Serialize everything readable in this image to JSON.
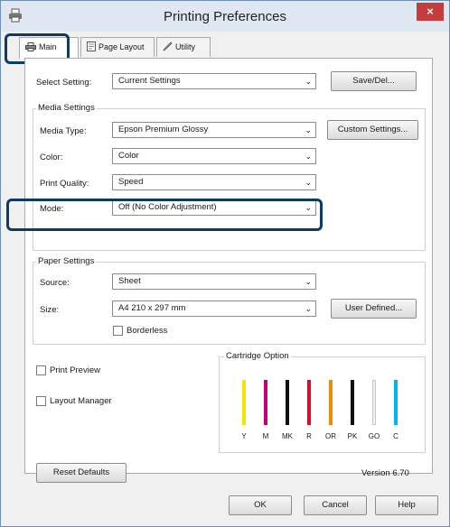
{
  "window": {
    "title": "Printing Preferences",
    "close_label": "×"
  },
  "tabs": [
    {
      "label": "Main",
      "active": true
    },
    {
      "label": "Page Layout",
      "active": false
    },
    {
      "label": "Utility",
      "active": false
    }
  ],
  "select_setting": {
    "label": "Select Setting:",
    "value": "Current Settings",
    "button": "Save/Del..."
  },
  "media_settings": {
    "title": "Media Settings",
    "media_type": {
      "label": "Media Type:",
      "value": "Epson Premium Glossy"
    },
    "custom_button": "Custom Settings...",
    "color": {
      "label": "Color:",
      "value": "Color"
    },
    "print_quality": {
      "label": "Print Quality:",
      "value": "Speed"
    },
    "mode": {
      "label": "Mode:",
      "value": "Off (No Color Adjustment)"
    }
  },
  "paper_settings": {
    "title": "Paper Settings",
    "source": {
      "label": "Source:",
      "value": "Sheet"
    },
    "size": {
      "label": "Size:",
      "value": "A4 210 x 297 mm"
    },
    "user_defined_button": "User Defined...",
    "borderless": {
      "label": "Borderless",
      "checked": false
    }
  },
  "print_preview": {
    "label": "Print Preview",
    "checked": false
  },
  "layout_manager": {
    "label": "Layout Manager",
    "checked": false
  },
  "cartridge_option": {
    "title": "Cartridge Option",
    "inks": [
      {
        "code": "Y",
        "color": "#f2e600"
      },
      {
        "code": "M",
        "color": "#c2007a"
      },
      {
        "code": "MK",
        "color": "#111111"
      },
      {
        "code": "R",
        "color": "#d5102a"
      },
      {
        "code": "OR",
        "color": "#f08a00"
      },
      {
        "code": "PK",
        "color": "#111111"
      },
      {
        "code": "GO",
        "color": "#f0f0f0"
      },
      {
        "code": "C",
        "color": "#00b7e8"
      }
    ]
  },
  "reset_defaults": "Reset Defaults",
  "version": "Version 6.70",
  "footer": {
    "ok": "OK",
    "cancel": "Cancel",
    "help": "Help"
  },
  "colors": {
    "highlight": "#0f3a66",
    "title_bar": "#dfe8f2",
    "close": "#c53c3c"
  }
}
